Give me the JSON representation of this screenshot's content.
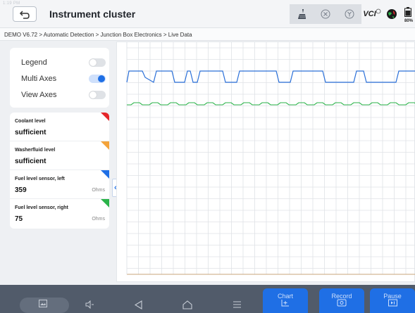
{
  "status": {
    "text": "1:19 PM"
  },
  "header": {
    "title": "Instrument cluster",
    "icons": [
      "broom-icon",
      "close-circle-icon",
      "y-circle-icon",
      "vci-icon",
      "globe-icon",
      "battery-icon"
    ],
    "vci_label": "VCI",
    "battery_label": "80%"
  },
  "breadcrumb": {
    "text": "DEMO V6.72 > Automatic Detection  > Junction Box Electronics > Live Data"
  },
  "panel": {
    "toggles": [
      {
        "label": "Legend",
        "on": false
      },
      {
        "label": "Multi Axes",
        "on": true
      },
      {
        "label": "View Axes",
        "on": false
      }
    ],
    "cards": [
      {
        "name": "Coolant level",
        "value": "sufficient",
        "unit": "",
        "color": "#e5262a"
      },
      {
        "name": "Washerfluid level",
        "value": "sufficient",
        "unit": "",
        "color": "#f3a33a"
      },
      {
        "name": "Fuel level sensor, left",
        "value": "359",
        "unit": "Ohms",
        "color": "#1f6fe5"
      },
      {
        "name": "Fuel level sensor, right",
        "value": "75",
        "unit": "Ohms",
        "color": "#2bb34a"
      }
    ],
    "collapse_glyph": "«"
  },
  "chart_data": {
    "type": "line",
    "grid": true,
    "series": [
      {
        "color": "#2a6fd8",
        "pattern": "square-pulse",
        "high": 1,
        "low": 0
      },
      {
        "color": "#2bb34a",
        "pattern": "small-ripple",
        "high": 1,
        "low": 0
      }
    ]
  },
  "actions": [
    {
      "label": "Chart",
      "icon": "chart-add-icon"
    },
    {
      "label": "Record",
      "icon": "record-icon"
    },
    {
      "label": "Pause",
      "icon": "pause-icon"
    }
  ],
  "nav": [
    "screenshot-icon",
    "volume-icon",
    "back-nav-icon",
    "home-nav-icon",
    "recents-nav-icon"
  ]
}
